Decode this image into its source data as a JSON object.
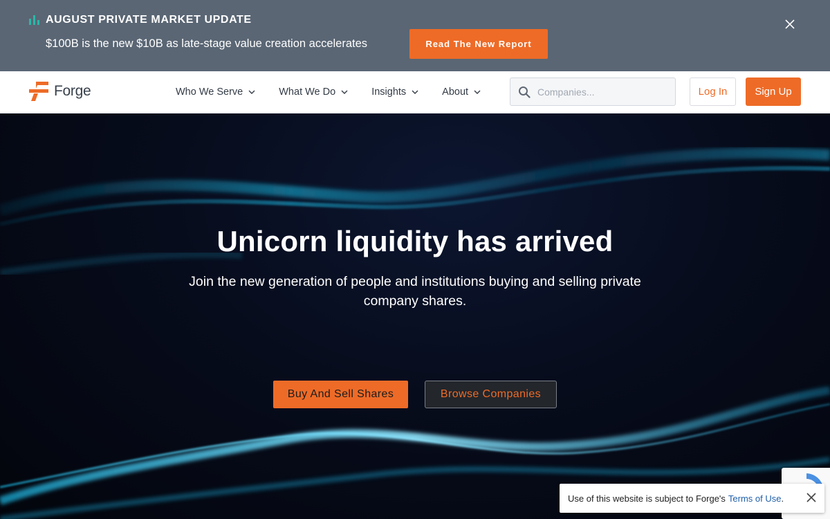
{
  "announcement": {
    "title": "AUGUST PRIVATE MARKET UPDATE",
    "text": "$100B is the new $10B as late-stage value creation accelerates",
    "button_label": "Read The New Report",
    "icon": "bar-chart-icon",
    "close_icon": "close-icon"
  },
  "nav": {
    "logo_text": "Forge",
    "items": [
      {
        "label": "Who We Serve"
      },
      {
        "label": "What We Do"
      },
      {
        "label": "Insights"
      },
      {
        "label": "About"
      }
    ],
    "search_placeholder": "Companies...",
    "login_label": "Log In",
    "signup_label": "Sign Up"
  },
  "hero": {
    "title": "Unicorn liquidity has arrived",
    "subtitle": "Join the new generation of people and institutions buying and selling private company shares.",
    "primary_button": "Buy And Sell Shares",
    "secondary_button": "Browse Companies"
  },
  "notice": {
    "text": "Use of this website is subject to Forge's",
    "link_text": "Terms of Use",
    "trailing": "."
  },
  "colors": {
    "accent": "#ee6b27",
    "announcement_bg": "#5a6674",
    "hero_bg": "#050814",
    "teal": "#2bb7a8",
    "link": "#1f5faa"
  }
}
